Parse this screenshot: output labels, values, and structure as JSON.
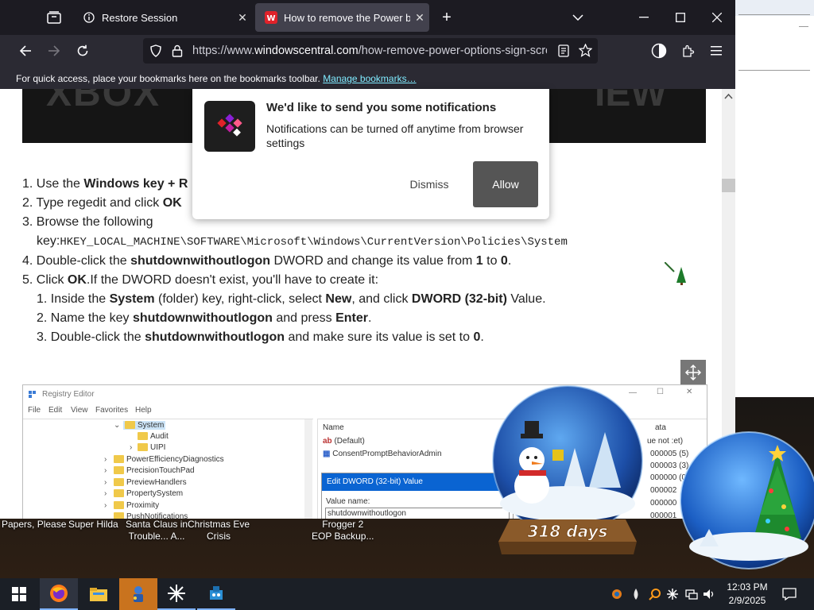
{
  "browser": {
    "tabs": [
      {
        "title": "Restore Session",
        "icon": "info-icon",
        "active": false
      },
      {
        "title": "How to remove the Power butto",
        "icon": "windowscentral-favicon",
        "active": true
      }
    ],
    "url": {
      "scheme": "https://www.",
      "host": "windowscentral.com",
      "path": "/how-remove-power-options-sign-scree"
    },
    "bookmarks_bar": {
      "text": "For quick access, place your bookmarks here on the bookmarks toolbar.",
      "link": "Manage bookmarks…"
    }
  },
  "notification": {
    "title": "We'd like to send you some notifications",
    "body": "Notifications can be turned off anytime from browser settings",
    "dismiss": "Dismiss",
    "allow": "Allow"
  },
  "article": {
    "step1_pre": "1. Use the ",
    "step1_b": "Windows key + R",
    "step2_pre": "2. Type regedit and click ",
    "step2_b": "OK",
    "step3_a": "3. Browse the following",
    "step3_b": "key:",
    "step3_path": "HKEY_LOCAL_MACHINE\\SOFTWARE\\Microsoft\\Windows\\CurrentVersion\\Policies\\System",
    "step4_pre": "4. Double-click the ",
    "step4_b": "shutdownwithoutlogon",
    "step4_mid": " DWORD and change its value from ",
    "step4_v1": "1",
    "step4_to": " to ",
    "step4_v2": "0",
    "step4_end": ".",
    "step5_pre": "5. Click ",
    "step5_b": "OK",
    "step5_post": ".If the DWORD doesn't exist, you'll have to create it:",
    "sub1_pre": "1. Inside the ",
    "sub1_b1": "System",
    "sub1_mid": " (folder) key, right-click, select ",
    "sub1_b2": "New",
    "sub1_mid2": ", and click ",
    "sub1_b3": "DWORD (32-bit)",
    "sub1_end": " Value.",
    "sub2_pre": "2. Name the key ",
    "sub2_b1": "shutdownwithoutlogon",
    "sub2_mid": " and press ",
    "sub2_b2": "Enter",
    "sub2_end": ".",
    "sub3_pre": "3. Double-click the ",
    "sub3_b": "shutdownwithoutlogon",
    "sub3_mid": " and make sure its value is set to ",
    "sub3_v": "0",
    "sub3_end": "."
  },
  "regedit": {
    "title": "Registry Editor",
    "menu": [
      "File",
      "Edit",
      "View",
      "Favorites",
      "Help"
    ],
    "tree": [
      "System",
      "Audit",
      "UIPI",
      "PowerEfficiencyDiagnostics",
      "PrecisionTouchPad",
      "PreviewHandlers",
      "PropertySystem",
      "Proximity",
      "PushNotifications"
    ],
    "values_header": "Name",
    "values": [
      "(Default)",
      "ConsentPromptBehaviorAdmin"
    ],
    "data_column": [
      "ata",
      "ue not :et)",
      "000005 (5)",
      "000003 (3)",
      "000000 (0)",
      "000002",
      "000000",
      "000001"
    ],
    "dialog_title": "Edit DWORD (32-bit) Value",
    "dialog_label": "Value name:",
    "dialog_value": "shutdownwithoutlogon"
  },
  "desktop_icons": [
    {
      "line1": "Papers, Please",
      "line2": ""
    },
    {
      "line1": "Super Hilda",
      "line2": ""
    },
    {
      "line1": "Santa Claus in",
      "line2": "Trouble... A..."
    },
    {
      "line1": "Christmas Eve",
      "line2": "Crisis"
    },
    {
      "line1": "Frogger 2",
      "line2": "EOP Backup..."
    }
  ],
  "snow_globe": {
    "days": "318 days"
  },
  "taskbar": {
    "time": "12:03 PM",
    "date": "2/9/2025",
    "items": [
      "start-icon",
      "firefox-icon",
      "file-explorer-icon",
      "game-app-icon",
      "perplexity-icon",
      "app-icon"
    ]
  }
}
